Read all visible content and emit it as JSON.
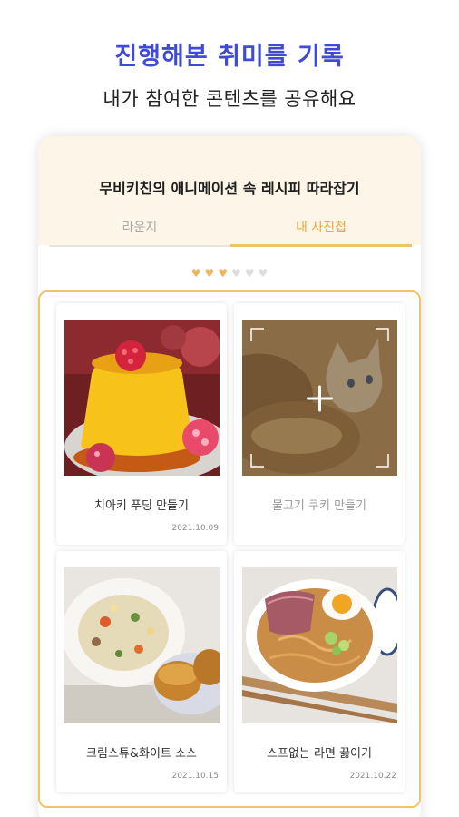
{
  "promo": {
    "headline": "진행해본 취미를 기록",
    "subline": "내가 참여한 콘텐츠를 공유해요"
  },
  "mission": {
    "title": "무비키친의 애니메이션 속 레시피 따라잡기"
  },
  "tabs": {
    "items": [
      {
        "label": "라운지",
        "active": false
      },
      {
        "label": "내 사진첩",
        "active": true
      }
    ]
  },
  "progress": {
    "completed": 3,
    "total": 6
  },
  "album": {
    "cards": [
      {
        "title": "치아키 푸딩 만들기",
        "date": "2021.10.09",
        "photo": "custard pudding with raspberries"
      },
      {
        "title": "물고기 쿠키 만들기",
        "date": "",
        "photo": "add-photo placeholder with anime cat"
      },
      {
        "title": "크림스튜&화이트 소스",
        "date": "2021.10.15",
        "photo": "cream stew plate with bread rolls"
      },
      {
        "title": "스프없는 라면 끓이기",
        "date": "2021.10.22",
        "photo": "ramen bowl with ham and egg"
      }
    ]
  },
  "colors": {
    "headline": "#3f4ad6",
    "accent": "#f0c16b",
    "header_bg": "#fdf6e8"
  }
}
